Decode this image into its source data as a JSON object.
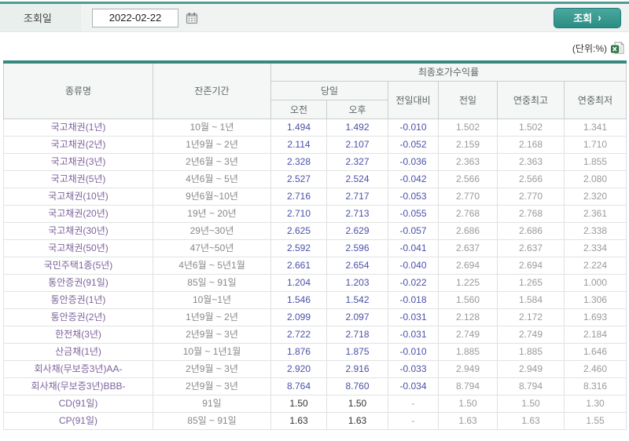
{
  "topbar": {
    "date_label": "조회일",
    "date_value": "2022-02-22",
    "search_label": "조회",
    "search_arrow": "›",
    "calendar_icon": "calendar-icon"
  },
  "unit": {
    "label": "(단위:%)",
    "excel_icon": "excel-download-icon"
  },
  "table": {
    "headers": {
      "type": "종류명",
      "period": "잔존기간",
      "group": "최종호가수익률",
      "today": "당일",
      "am": "오전",
      "pm": "오후",
      "vs_prev": "전일대비",
      "prev": "전일",
      "year_high": "연중최고",
      "year_low": "연중최저"
    },
    "rows": [
      {
        "name": "국고채권(1년)",
        "period": "10월 ~ 1년",
        "am": "1.494",
        "pm": "1.492",
        "chg": "-0.010",
        "prev": "1.502",
        "high": "1.502",
        "low": "1.341"
      },
      {
        "name": "국고채권(2년)",
        "period": "1년9월 ~ 2년",
        "am": "2.114",
        "pm": "2.107",
        "chg": "-0.052",
        "prev": "2.159",
        "high": "2.168",
        "low": "1.710"
      },
      {
        "name": "국고채권(3년)",
        "period": "2년6월 ~ 3년",
        "am": "2.328",
        "pm": "2.327",
        "chg": "-0.036",
        "prev": "2.363",
        "high": "2.363",
        "low": "1.855"
      },
      {
        "name": "국고채권(5년)",
        "period": "4년6월 ~ 5년",
        "am": "2.527",
        "pm": "2.524",
        "chg": "-0.042",
        "prev": "2.566",
        "high": "2.566",
        "low": "2.080"
      },
      {
        "name": "국고채권(10년)",
        "period": "9년6월~10년",
        "am": "2.716",
        "pm": "2.717",
        "chg": "-0.053",
        "prev": "2.770",
        "high": "2.770",
        "low": "2.320"
      },
      {
        "name": "국고채권(20년)",
        "period": "19년 ~ 20년",
        "am": "2.710",
        "pm": "2.713",
        "chg": "-0.055",
        "prev": "2.768",
        "high": "2.768",
        "low": "2.361"
      },
      {
        "name": "국고채권(30년)",
        "period": "29년~30년",
        "am": "2.625",
        "pm": "2.629",
        "chg": "-0.057",
        "prev": "2.686",
        "high": "2.686",
        "low": "2.338"
      },
      {
        "name": "국고채권(50년)",
        "period": "47년~50년",
        "am": "2.592",
        "pm": "2.596",
        "chg": "-0.041",
        "prev": "2.637",
        "high": "2.637",
        "low": "2.334"
      },
      {
        "name": "국민주택1종(5년)",
        "period": "4년6월 ~ 5년1월",
        "am": "2.661",
        "pm": "2.654",
        "chg": "-0.040",
        "prev": "2.694",
        "high": "2.694",
        "low": "2.224"
      },
      {
        "name": "통안증권(91일)",
        "period": "85일 ~ 91일",
        "am": "1.204",
        "pm": "1.203",
        "chg": "-0.022",
        "prev": "1.225",
        "high": "1.265",
        "low": "1.000"
      },
      {
        "name": "통안증권(1년)",
        "period": "10월~1년",
        "am": "1.546",
        "pm": "1.542",
        "chg": "-0.018",
        "prev": "1.560",
        "high": "1.584",
        "low": "1.306"
      },
      {
        "name": "통안증권(2년)",
        "period": "1년9월 ~ 2년",
        "am": "2.099",
        "pm": "2.097",
        "chg": "-0.031",
        "prev": "2.128",
        "high": "2.172",
        "low": "1.693"
      },
      {
        "name": "한전채(3년)",
        "period": "2년9월 ~ 3년",
        "am": "2.722",
        "pm": "2.718",
        "chg": "-0.031",
        "prev": "2.749",
        "high": "2.749",
        "low": "2.184"
      },
      {
        "name": "산금채(1년)",
        "period": "10월 ~ 1년1월",
        "am": "1.876",
        "pm": "1.875",
        "chg": "-0.010",
        "prev": "1.885",
        "high": "1.885",
        "low": "1.646"
      },
      {
        "name": "회사채(무보증3년)AA-",
        "period": "2년9월 ~ 3년",
        "am": "2.920",
        "pm": "2.916",
        "chg": "-0.033",
        "prev": "2.949",
        "high": "2.949",
        "low": "2.460"
      },
      {
        "name": "회사채(무보증3년)BBB-",
        "period": "2년9월 ~ 3년",
        "am": "8.764",
        "pm": "8.760",
        "chg": "-0.034",
        "prev": "8.794",
        "high": "8.794",
        "low": "8.316"
      },
      {
        "name": "CD(91일)",
        "period": "91일",
        "am": "1.50",
        "pm": "1.50",
        "chg": "-",
        "prev": "1.50",
        "high": "1.50",
        "low": "1.30"
      },
      {
        "name": "CP(91일)",
        "period": "85일 ~ 91일",
        "am": "1.63",
        "pm": "1.63",
        "chg": "-",
        "prev": "1.63",
        "high": "1.63",
        "low": "1.55"
      }
    ]
  },
  "colors": {
    "accent_teal": "#2f948b",
    "table_top_border": "#37897f",
    "value_blue": "#4a51a8",
    "name_purple": "#7d639b",
    "muted_gray": "#9a9a9a",
    "excel_green": "#2e7d46"
  }
}
